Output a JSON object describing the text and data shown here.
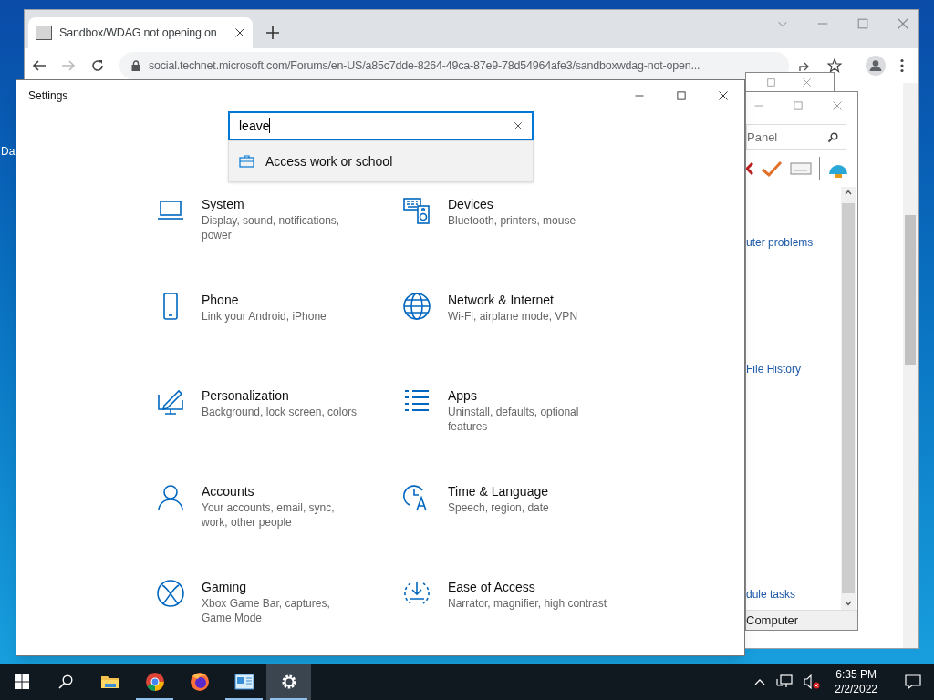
{
  "desktop": {
    "icon_label": "Da"
  },
  "browser": {
    "tab_title": "Sandbox/WDAG not opening on",
    "address": "social.technet.microsoft.com/Forums/en-US/a85c7dde-8264-49ca-87e9-78d54964afe3/sandboxwdag-not-open..."
  },
  "control_panel": {
    "search": {
      "placeholder": "Panel"
    },
    "links": [
      "uter problems",
      "File History",
      "dule tasks"
    ],
    "status_bar": "Computer"
  },
  "settings": {
    "title": "Settings",
    "search": {
      "value": "leave"
    },
    "suggestions": [
      {
        "label": "Access work or school"
      }
    ],
    "categories": [
      {
        "title": "System",
        "description": "Display, sound, notifications, power"
      },
      {
        "title": "Devices",
        "description": "Bluetooth, printers, mouse"
      },
      {
        "title": "Phone",
        "description": "Link your Android, iPhone"
      },
      {
        "title": "Network & Internet",
        "description": "Wi-Fi, airplane mode, VPN"
      },
      {
        "title": "Personalization",
        "description": "Background, lock screen, colors"
      },
      {
        "title": "Apps",
        "description": "Uninstall, defaults, optional features"
      },
      {
        "title": "Accounts",
        "description": "Your accounts, email, sync, work, other people"
      },
      {
        "title": "Time & Language",
        "description": "Speech, region, date"
      },
      {
        "title": "Gaming",
        "description": "Xbox Game Bar, captures, Game Mode"
      },
      {
        "title": "Ease of Access",
        "description": "Narrator, magnifier, high contrast"
      }
    ]
  },
  "taskbar": {
    "apps": [
      {
        "kind": "explorer",
        "running": false,
        "selected": false
      },
      {
        "kind": "chrome",
        "running": true,
        "selected": false
      },
      {
        "kind": "firefox",
        "running": false,
        "selected": false
      },
      {
        "kind": "control-panel",
        "running": true,
        "selected": false
      },
      {
        "kind": "settings",
        "running": true,
        "selected": true
      }
    ],
    "time": "6:35 PM",
    "date": "2/2/2022"
  }
}
